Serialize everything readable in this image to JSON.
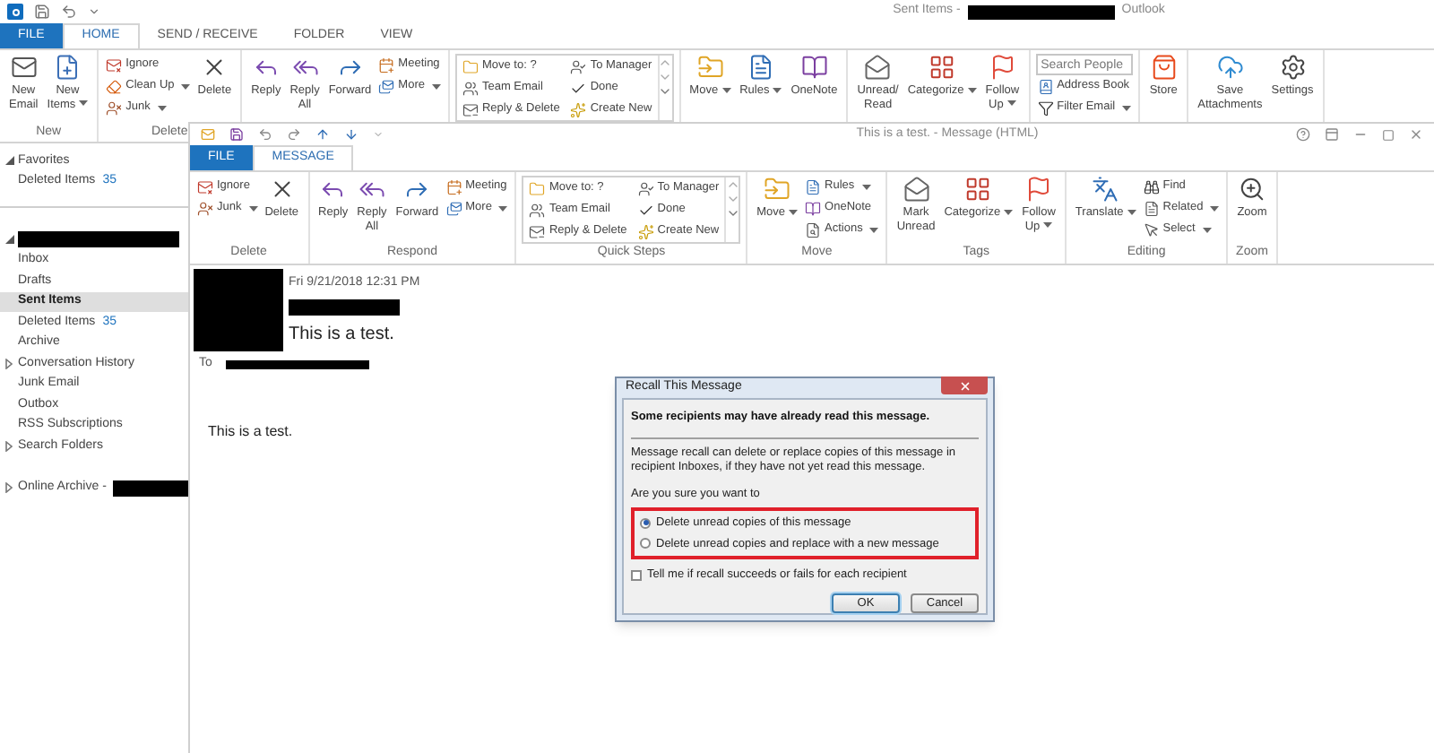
{
  "main_window": {
    "title": "Sent Items -",
    "title_suffix": "Outlook",
    "tabs": [
      {
        "label": "FILE",
        "kind": "file",
        "selected": false
      },
      {
        "label": "HOME",
        "kind": "tab",
        "selected": true
      },
      {
        "label": "SEND / RECEIVE",
        "kind": "tab",
        "selected": false
      },
      {
        "label": "FOLDER",
        "kind": "tab",
        "selected": false
      },
      {
        "label": "VIEW",
        "kind": "tab",
        "selected": false
      }
    ],
    "ribbon": [
      {
        "label": "New",
        "items": [
          {
            "kind": "large",
            "label": "New\nEmail"
          },
          {
            "kind": "large",
            "label": "New\nItems",
            "dropdown": true
          }
        ]
      },
      {
        "label": "Delete",
        "items": [
          {
            "kind": "small",
            "label": "Ignore"
          },
          {
            "kind": "small",
            "label": "Clean Up",
            "dropdown": true
          },
          {
            "kind": "small",
            "label": "Junk",
            "dropdown": true
          },
          {
            "kind": "large",
            "label": "Delete"
          }
        ]
      },
      {
        "items": [
          {
            "kind": "large",
            "label": "Reply"
          },
          {
            "kind": "large",
            "label": "Reply\nAll"
          },
          {
            "kind": "large",
            "label": "Forward"
          },
          {
            "kind": "small",
            "label": "Meeting"
          },
          {
            "kind": "small",
            "label": "More",
            "dropdown": true
          }
        ]
      },
      {
        "kind": "gallery",
        "items": [
          {
            "kind": "small",
            "label": "Move to: ?"
          },
          {
            "kind": "small",
            "label": "Team Email"
          },
          {
            "kind": "small",
            "label": "Reply & Delete"
          },
          {
            "kind": "small",
            "label": "To Manager"
          },
          {
            "kind": "small",
            "label": "Done"
          },
          {
            "kind": "small",
            "label": "Create New"
          }
        ]
      },
      {
        "items": [
          {
            "kind": "large",
            "label": "Move",
            "dropdown": true
          },
          {
            "kind": "large",
            "label": "Rules",
            "dropdown": true
          },
          {
            "kind": "large",
            "label": "OneNote"
          }
        ]
      },
      {
        "items": [
          {
            "kind": "large",
            "label": "Unread/\nRead"
          },
          {
            "kind": "large",
            "label": "Categorize",
            "dropdown": true
          },
          {
            "kind": "large",
            "label": "Follow\nUp",
            "dropdown": true
          }
        ]
      },
      {
        "items": [
          {
            "kind": "search",
            "placeholder": "Search People"
          },
          {
            "kind": "small",
            "label": "Address Book"
          },
          {
            "kind": "small",
            "label": "Filter Email",
            "dropdown": true
          }
        ]
      },
      {
        "items": [
          {
            "kind": "large",
            "label": "Store"
          }
        ]
      },
      {
        "items": [
          {
            "kind": "large",
            "label": "Save\nAttachments"
          },
          {
            "kind": "large",
            "label": "Settings"
          }
        ]
      }
    ]
  },
  "sidebar": {
    "folders": [
      {
        "label": "Favorites",
        "expanded": true,
        "selected": false,
        "children": [
          {
            "label": "Deleted Items",
            "count": "35",
            "selected": false
          }
        ]
      },
      {
        "redacted": true,
        "expanded": true,
        "selected": false,
        "children": [
          {
            "label": "Inbox",
            "selected": false
          },
          {
            "label": "Drafts",
            "selected": false
          },
          {
            "label": "Sent Items",
            "selected": true
          },
          {
            "label": "Deleted Items",
            "count": "35",
            "selected": false
          },
          {
            "label": "Archive",
            "selected": false
          },
          {
            "label": "Conversation History",
            "expanded": false,
            "selected": false
          },
          {
            "label": "Junk Email",
            "selected": false
          },
          {
            "label": "Outbox",
            "selected": false
          },
          {
            "label": "RSS Subscriptions",
            "selected": false
          },
          {
            "label": "Search Folders",
            "expanded": false,
            "selected": false
          }
        ]
      },
      {
        "label": "Online Archive -",
        "redacted": true,
        "expanded": false,
        "selected": false
      }
    ]
  },
  "message_window": {
    "title": "This is a test. - Message (HTML)",
    "tabs": [
      {
        "label": "FILE",
        "kind": "file",
        "selected": false
      },
      {
        "label": "MESSAGE",
        "kind": "tab",
        "selected": true
      }
    ],
    "ribbon": [
      {
        "label": "Delete",
        "items": [
          {
            "kind": "small",
            "label": "Ignore"
          },
          {
            "kind": "small",
            "label": "Junk",
            "dropdown": true
          },
          {
            "kind": "large",
            "label": "Delete"
          }
        ]
      },
      {
        "label": "Respond",
        "items": [
          {
            "kind": "large",
            "label": "Reply"
          },
          {
            "kind": "large",
            "label": "Reply\nAll"
          },
          {
            "kind": "large",
            "label": "Forward"
          },
          {
            "kind": "small",
            "label": "Meeting"
          },
          {
            "kind": "small",
            "label": "More",
            "dropdown": true
          }
        ]
      },
      {
        "label": "Quick Steps",
        "kind": "gallery",
        "items": [
          {
            "kind": "small",
            "label": "Move to: ?"
          },
          {
            "kind": "small",
            "label": "Team Email"
          },
          {
            "kind": "small",
            "label": "Reply & Delete"
          },
          {
            "kind": "small",
            "label": "To Manager"
          },
          {
            "kind": "small",
            "label": "Done"
          },
          {
            "kind": "small",
            "label": "Create New"
          }
        ]
      },
      {
        "label": "Move",
        "items": [
          {
            "kind": "large",
            "label": "Move",
            "dropdown": true
          },
          {
            "kind": "small",
            "label": "Rules",
            "dropdown": true
          },
          {
            "kind": "small",
            "label": "OneNote"
          },
          {
            "kind": "small",
            "label": "Actions",
            "dropdown": true
          }
        ]
      },
      {
        "label": "Tags",
        "items": [
          {
            "kind": "large",
            "label": "Mark\nUnread"
          },
          {
            "kind": "large",
            "label": "Categorize",
            "dropdown": true
          },
          {
            "kind": "large",
            "label": "Follow\nUp",
            "dropdown": true
          }
        ]
      },
      {
        "label": "Editing",
        "items": [
          {
            "kind": "large",
            "label": "Translate",
            "dropdown": true
          },
          {
            "kind": "small",
            "label": "Find"
          },
          {
            "kind": "small",
            "label": "Related",
            "dropdown": true
          },
          {
            "kind": "small",
            "label": "Select",
            "dropdown": true
          }
        ]
      },
      {
        "label": "Zoom",
        "items": [
          {
            "kind": "large",
            "label": "Zoom"
          }
        ]
      }
    ],
    "message": {
      "date": "Fri 9/21/2018 12:31 PM",
      "subject": "This is a test.",
      "to_label": "To",
      "body": "This is a test."
    }
  },
  "dialog": {
    "title": "Recall This Message",
    "warning": "Some recipients may have already read this message.",
    "explanation": "Message recall can delete or replace copies of this message in recipient Inboxes, if they have not yet read this message.",
    "question": "Are you sure you want to",
    "options": [
      {
        "label": "Delete unread copies of this message",
        "selected": true
      },
      {
        "label": "Delete unread copies and replace with a new message",
        "selected": false
      }
    ],
    "notify": {
      "label": "Tell me if recall succeeds or fails for each recipient",
      "checked": false
    },
    "buttons": [
      {
        "label": "OK",
        "default": true
      },
      {
        "label": "Cancel",
        "default": false
      }
    ]
  }
}
